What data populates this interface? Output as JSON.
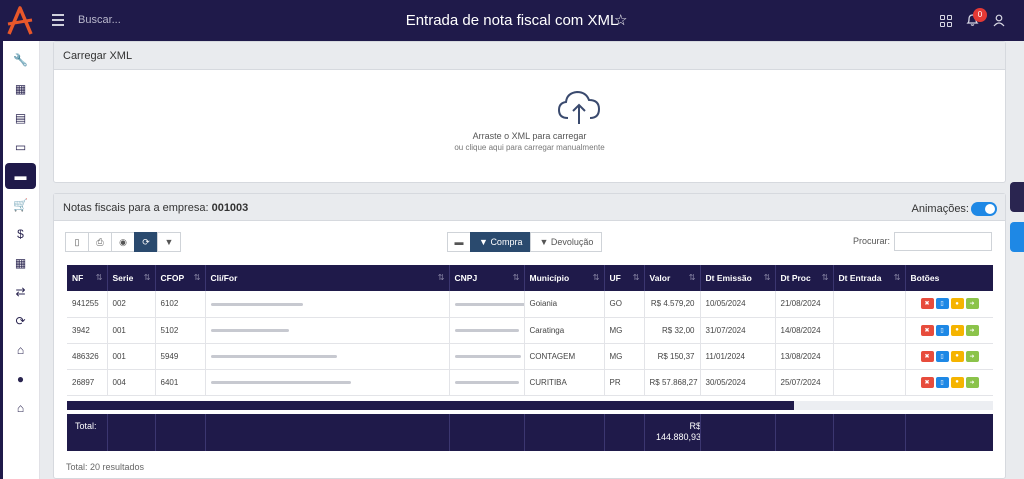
{
  "header": {
    "search_placeholder": "Buscar...",
    "title": "Entrada de nota fiscal com XML",
    "notification_count": "0",
    "colors": {
      "bar": "#1f1a4a",
      "accent": "#e53935"
    }
  },
  "sidebar": {
    "items": [
      {
        "icon": "wrench-icon",
        "glyph": "🔧"
      },
      {
        "icon": "calculator-icon",
        "glyph": "▦"
      },
      {
        "icon": "book-icon",
        "glyph": "▤"
      },
      {
        "icon": "money-icon",
        "glyph": "▭"
      },
      {
        "icon": "briefcase-icon",
        "glyph": "▬",
        "active": true
      },
      {
        "icon": "cart-icon",
        "glyph": "🛒"
      },
      {
        "icon": "dollar-icon",
        "glyph": "$"
      },
      {
        "icon": "table-icon",
        "glyph": "▦"
      },
      {
        "icon": "shuffle-icon",
        "glyph": "⇄"
      },
      {
        "icon": "retweet-icon",
        "glyph": "⟳"
      },
      {
        "icon": "basket-icon",
        "glyph": "⌂"
      },
      {
        "icon": "user-icon",
        "glyph": "●"
      },
      {
        "icon": "home-icon",
        "glyph": "⌂"
      }
    ]
  },
  "upload_panel": {
    "title": "Carregar XML",
    "drop_text": "Arraste o XML para carregar",
    "drop_subtext": "ou clique aqui para carregar manualmente"
  },
  "notes_panel": {
    "title_prefix": "Notas fiscais para a empresa: ",
    "company": "001003",
    "animations_label": "Animações:",
    "filters": {
      "compra": "Compra",
      "devolucao": "Devolução"
    },
    "search_label": "Procurar:",
    "columns": [
      "NF",
      "Serie",
      "CFOP",
      "Cli/For",
      "CNPJ",
      "Município",
      "UF",
      "Valor",
      "Dt Emissão",
      "Dt Proc",
      "Dt Entrada",
      "Botões"
    ],
    "rows": [
      {
        "nf": "941255",
        "serie": "002",
        "cfop": "6102",
        "municipio": "Goiania",
        "uf": "GO",
        "valor": "R$ 4.579,20",
        "emissao": "10/05/2024",
        "proc": "21/08/2024",
        "entrada": ""
      },
      {
        "nf": "3942",
        "serie": "001",
        "cfop": "5102",
        "municipio": "Caratinga",
        "uf": "MG",
        "valor": "R$ 32,00",
        "emissao": "31/07/2024",
        "proc": "14/08/2024",
        "entrada": ""
      },
      {
        "nf": "486326",
        "serie": "001",
        "cfop": "5949",
        "municipio": "CONTAGEM",
        "uf": "MG",
        "valor": "R$ 150,37",
        "emissao": "11/01/2024",
        "proc": "13/08/2024",
        "entrada": ""
      },
      {
        "nf": "26897",
        "serie": "004",
        "cfop": "6401",
        "municipio": "CURITIBA",
        "uf": "PR",
        "valor": "R$ 57.868,27",
        "emissao": "30/05/2024",
        "proc": "25/07/2024",
        "entrada": ""
      }
    ],
    "total_label": "Total:",
    "total_value_line1": "R$",
    "total_value_line2": "144.880,93",
    "results": "Total: 20 resultados"
  }
}
